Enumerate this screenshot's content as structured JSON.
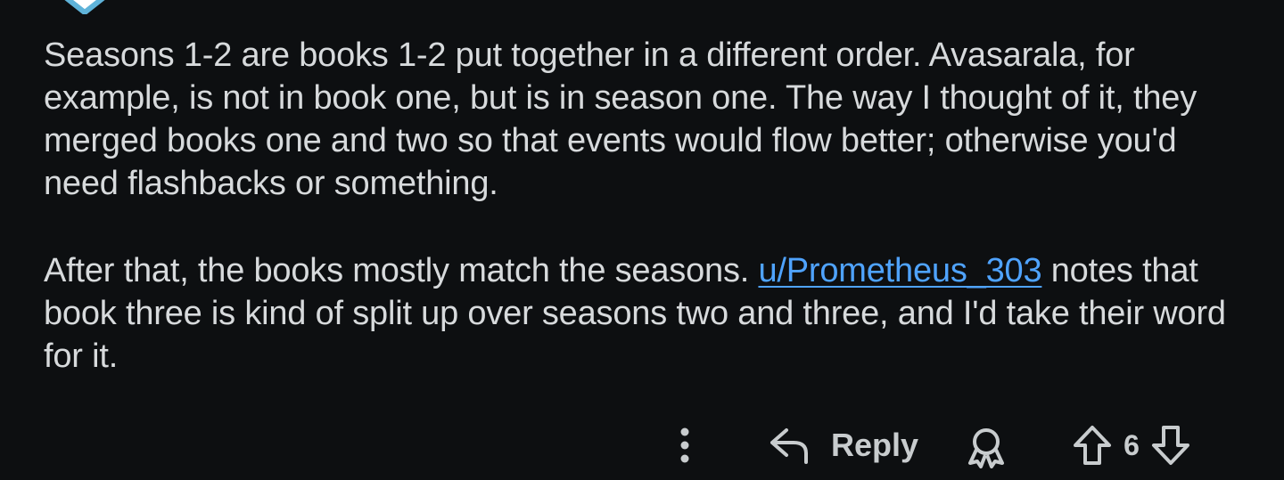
{
  "comment": {
    "paragraph_1": "Seasons 1-2 are books 1-2 put together in a different order. Avasarala, for example, is not in book one, but is in season one. The way I thought of it, they merged books one and two so that events would flow better; otherwise you'd need flashbacks or something.",
    "paragraph_2_before": "After that, the books mostly match the seasons. ",
    "user_link": "u/Prometheus_303",
    "paragraph_2_after": " notes that book three is kind of split up over seasons two and three, and I'd take their word for it."
  },
  "actions": {
    "reply_label": "Reply",
    "vote_count": "6"
  },
  "colors": {
    "background": "#0d0f11",
    "text": "#d7dadc",
    "link": "#4fa3ff",
    "icon": "#c8ccce",
    "avatar_accent": "#5fb3d9"
  },
  "icons": [
    "more-vertical-icon",
    "reply-arrow-icon",
    "award-icon",
    "upvote-arrow-icon",
    "downvote-arrow-icon"
  ]
}
